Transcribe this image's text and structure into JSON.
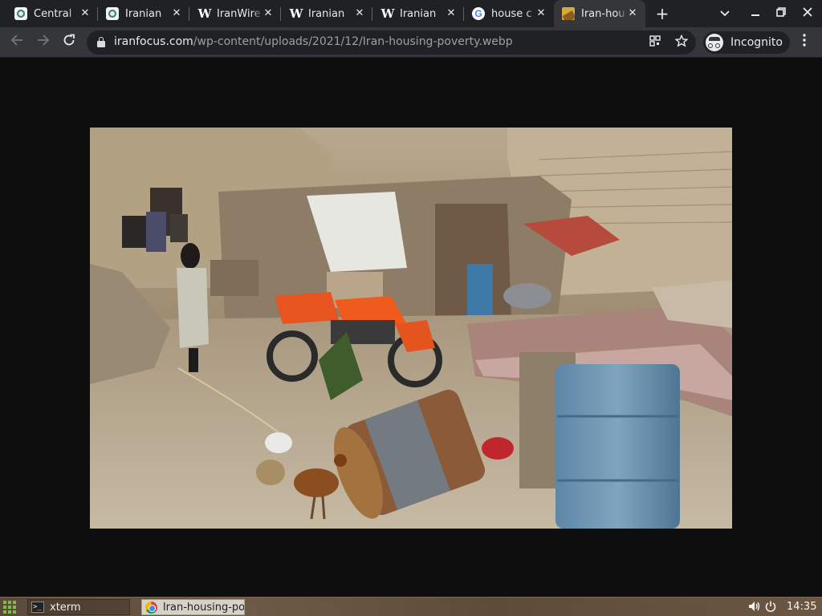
{
  "browser": {
    "tabs": [
      {
        "title": "Central",
        "favicon": "seal-icon"
      },
      {
        "title": "Iranian",
        "favicon": "seal-icon"
      },
      {
        "title": "IranWire",
        "favicon": "w-logo-icon"
      },
      {
        "title": "Iranian",
        "favicon": "w-logo-icon"
      },
      {
        "title": "Iranian",
        "favicon": "w-logo-icon"
      },
      {
        "title": "house c",
        "favicon": "google-icon"
      },
      {
        "title": "Iran-hou",
        "favicon": "image-icon",
        "active": true
      }
    ],
    "close_glyph": "✕",
    "new_tab_glyph": "+",
    "url_host": "iranfocus.com",
    "url_path": "/wp-content/uploads/2021/12/Iran-housing-poverty.webp",
    "profile_label": "Incognito",
    "google_letter": "G"
  },
  "taskbar": {
    "items": [
      {
        "label": "xterm",
        "icon": "terminal-icon"
      },
      {
        "label": "Iran-housing-po",
        "icon": "chrome-icon"
      }
    ],
    "terminal_glyph": ">_",
    "clock": "14:35"
  },
  "colors": {
    "tabstrip": "#202124",
    "toolbar": "#35363a",
    "page_background": "#0e0e0e",
    "launcher_green": "#7bc043"
  }
}
